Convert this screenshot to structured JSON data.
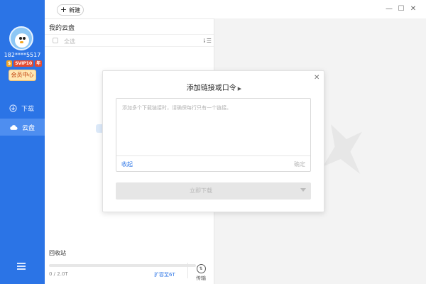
{
  "sidebar": {
    "username": "182****5517",
    "badges": [
      "$",
      "SVIP10",
      "年"
    ],
    "vip_center": "会员中心",
    "items": [
      {
        "label": "下载",
        "icon": "download-arrow-icon",
        "active": false
      },
      {
        "label": "云盘",
        "icon": "cloud-icon",
        "active": true
      }
    ],
    "accent_color": "#2b74e6"
  },
  "toolbar": {
    "new_label": "新建"
  },
  "file_panel": {
    "title": "我的云盘",
    "select_all": "全选",
    "recycle": "回收站",
    "storage_text": "0 / 2.0T",
    "storage_used": 0,
    "expand_link": "扩容至6T",
    "transfer_label": "传输"
  },
  "modal": {
    "title": "添加链接或口令",
    "placeholder": "添加多个下载链接时，请确保每行只有一个链接。",
    "collapse_label": "收起",
    "confirm_label": "确定",
    "download_label": "立即下载"
  }
}
